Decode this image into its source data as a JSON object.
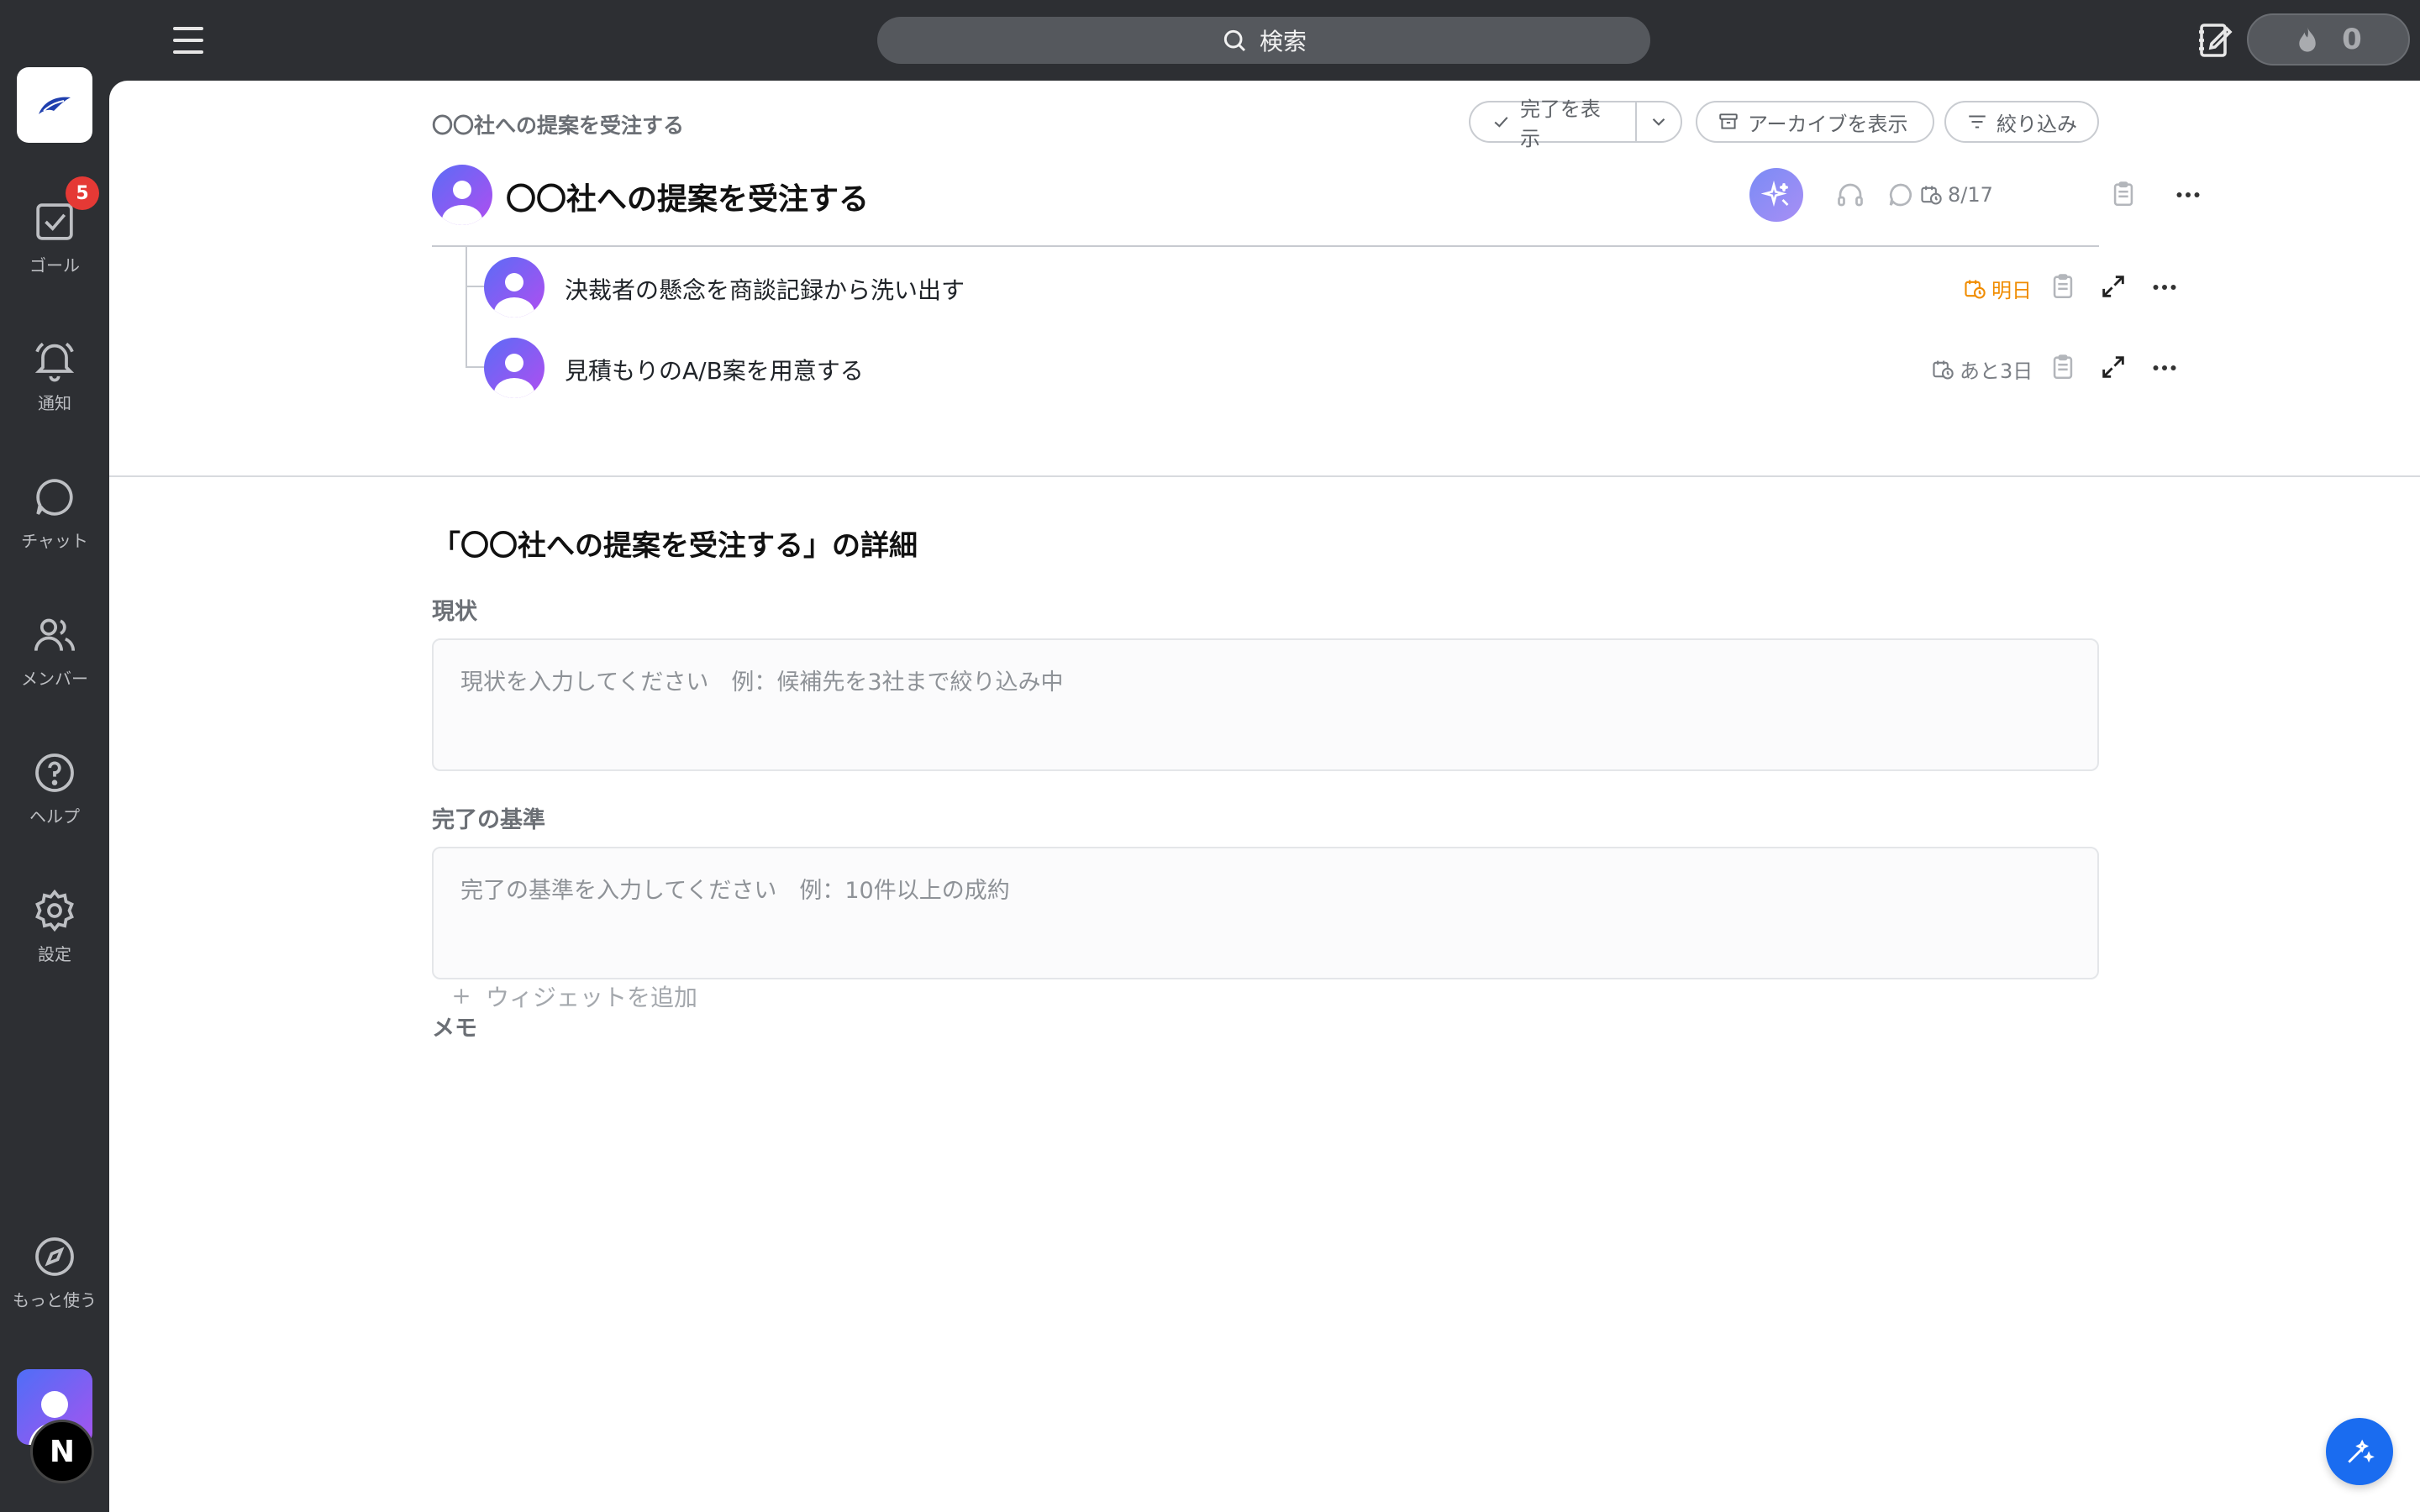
{
  "topbar": {
    "search_label": "検索",
    "streak_count": "0"
  },
  "sidebar": {
    "goal_badge_count": "5",
    "items": [
      {
        "label": "ゴール",
        "icon": "checkbox-icon"
      },
      {
        "label": "通知",
        "icon": "bell-icon"
      },
      {
        "label": "チャット",
        "icon": "chat-bubble-icon"
      },
      {
        "label": "メンバー",
        "icon": "users-icon"
      },
      {
        "label": "ヘルプ",
        "icon": "help-circle-icon"
      },
      {
        "label": "設定",
        "icon": "gear-icon"
      }
    ],
    "more_label": "もっと使う",
    "user_badge_letter": "N"
  },
  "header": {
    "breadcrumb": "〇〇社への提案を受注する",
    "show_completed_label": "完了を表示",
    "show_archive_label": "アーカイブを表示",
    "filter_label": "絞り込み"
  },
  "goal": {
    "title": "〇〇社への提案を受注する",
    "due": "8/17",
    "subgoals": [
      {
        "title": "決裁者の懸念を商談記録から洗い出す",
        "due": "明日",
        "due_color": "#f08c00"
      },
      {
        "title": "見積もりのA/B案を用意する",
        "due": "あと3日",
        "due_color": "#7a7e84"
      }
    ]
  },
  "detail": {
    "heading": "「〇〇社への提案を受注する」の詳細",
    "status_label": "現状",
    "status_placeholder": "現状を入力してください　例：候補先を3社まで絞り込み中",
    "criteria_label": "完了の基準",
    "criteria_placeholder": "完了の基準を入力してください　例：10件以上の成約",
    "memo_label": "メモ",
    "add_widget_label": "ウィジェットを追加"
  },
  "colors": {
    "accent": "#1a6cf0",
    "sidebar_bg": "#2d2f33",
    "badge": "#e53935",
    "due_soon": "#f08c00"
  }
}
